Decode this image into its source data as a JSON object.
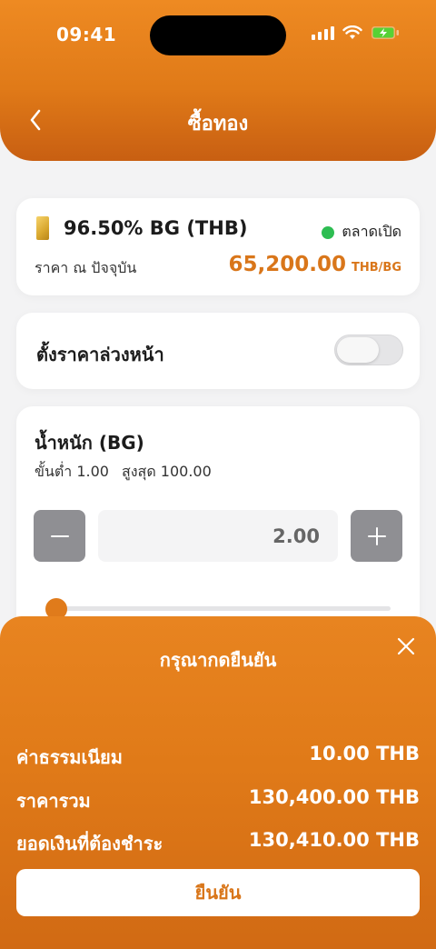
{
  "status_bar": {
    "time": "09:41"
  },
  "header": {
    "title": "ซื้อทอง"
  },
  "price_card": {
    "asset_name": "96.50% BG (THB)",
    "market_status": "ตลาดเปิด",
    "current_price_label": "ราคา ณ ปัจจุบัน",
    "price": "65,200.00",
    "price_unit": "THB/BG"
  },
  "advance_order": {
    "label": "ตั้งราคาล่วงหน้า",
    "enabled": false
  },
  "weight": {
    "title": "น้ำหนัก (BG)",
    "min_text": "ขั้นต่ำ 1.00",
    "max_text": "สูงสุด 100.00",
    "value": "2.00",
    "slider_fraction": 0.0101
  },
  "confirm_sheet": {
    "title": "กรุณากดยืนยัน",
    "rows": [
      {
        "label": "ค่าธรรมเนียม",
        "value": "10.00 THB"
      },
      {
        "label": "ราคารวม",
        "value": "130,400.00 THB"
      },
      {
        "label": "ยอดเงินที่ต้องชำระ",
        "value": "130,410.00 THB"
      }
    ],
    "confirm_label": "ยืนยัน"
  },
  "colors": {
    "accent": "#e07a18",
    "price_text": "#d9761a",
    "market_open": "#2dbd52",
    "stepper_button": "#8f8f93"
  }
}
